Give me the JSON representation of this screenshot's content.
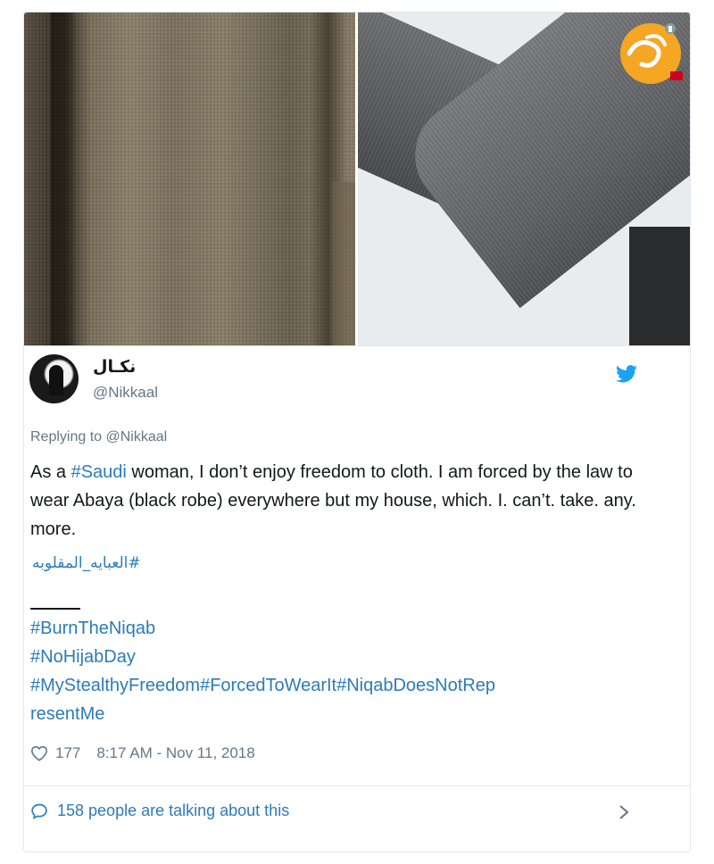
{
  "tweet": {
    "display_name": "نكـال",
    "handle": "@Nikkaal",
    "replying_to_label": "Replying to",
    "replying_to_handle": "@Nikkaal",
    "text_before_tag": "As a ",
    "text_tag": "#Saudi",
    "text_after_tag": " woman, I don’t enjoy freedom to cloth. I am forced by the law to wear Abaya (black robe) everywhere but my house, which. I. can’t. take. any. more.",
    "arabic_hashtag": "#العبايه_المقلوبه",
    "hashtags": [
      "#BurnTheNiqab",
      "#NoHijabDay",
      "#MyStealthyFreedom#ForcedToWearIt#NiqabDoesNotRep",
      "resentMe"
    ],
    "likes": "177",
    "timestamp": "8:17 AM - Nov 11, 2018",
    "talking": "158 people are talking about this"
  },
  "icons": {
    "avatar": "profile-avatar",
    "brand": "twitter-bird-icon",
    "like": "heart-icon",
    "conversation": "speech-bubble-icon",
    "more": "chevron-right-icon",
    "watermark": "watermark-logo"
  },
  "colors": {
    "link": "#2b7bb9",
    "secondary_text": "#657786",
    "twitter_blue": "#1da1f2",
    "watermark_orange": "#f5a623"
  }
}
